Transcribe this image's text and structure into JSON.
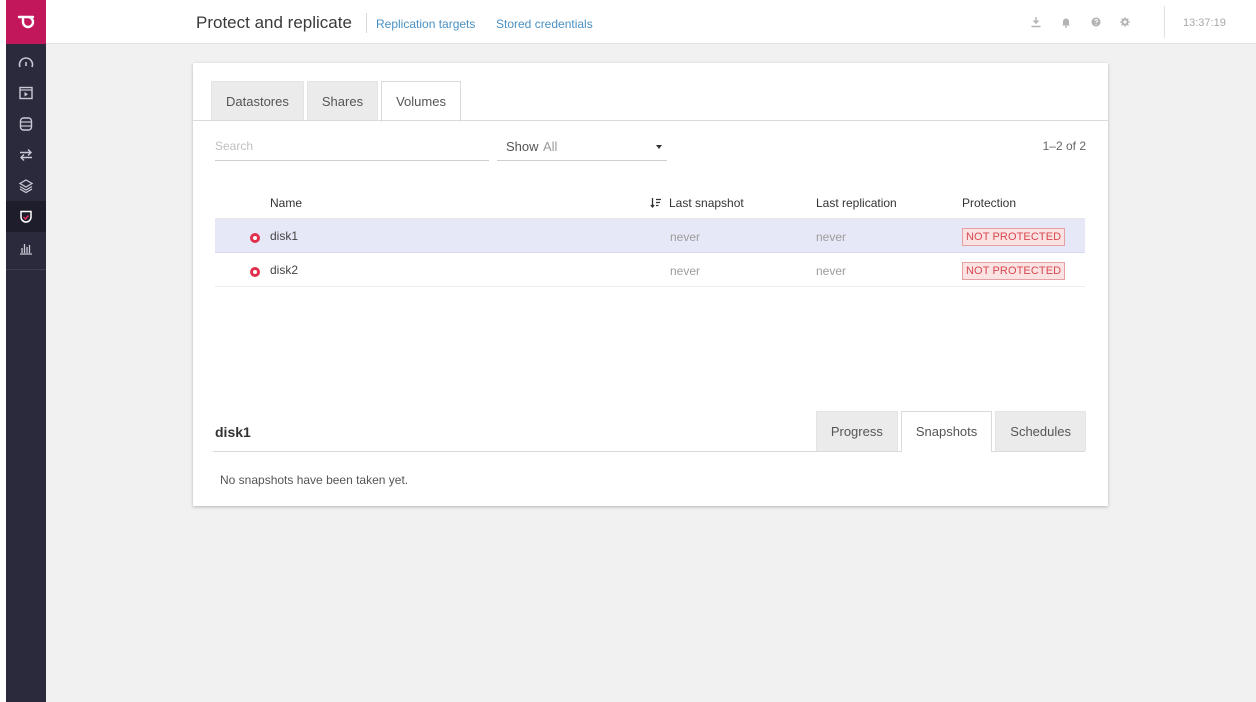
{
  "topbar": {
    "title": "Protect and replicate",
    "links": [
      "Replication targets",
      "Stored credentials"
    ],
    "clock": "13:37:19"
  },
  "sidebar": {
    "logo": "logo-icon",
    "items": [
      {
        "icon": "dashboard-icon"
      },
      {
        "icon": "vm-icon"
      },
      {
        "icon": "storage-icon"
      },
      {
        "icon": "transfer-icon"
      },
      {
        "icon": "layers-icon"
      },
      {
        "icon": "shield-icon",
        "active": true
      },
      {
        "icon": "stats-icon"
      }
    ]
  },
  "tabs": [
    "Datastores",
    "Shares",
    "Volumes"
  ],
  "active_tab": "Volumes",
  "search": {
    "placeholder": "Search"
  },
  "filter": {
    "label": "Show",
    "value": "All"
  },
  "pager": "1–2 of 2",
  "table": {
    "headers": [
      "Name",
      "Last snapshot",
      "Last replication",
      "Protection"
    ],
    "rows": [
      {
        "name": "disk1",
        "last_snapshot": "never",
        "last_replication": "never",
        "protection": "NOT PROTECTED",
        "selected": true
      },
      {
        "name": "disk2",
        "last_snapshot": "never",
        "last_replication": "never",
        "protection": "NOT PROTECTED",
        "selected": false
      }
    ]
  },
  "detail": {
    "title": "disk1",
    "tabs": [
      "Progress",
      "Snapshots",
      "Schedules"
    ],
    "active_tab": "Snapshots",
    "message": "No snapshots have been taken yet."
  },
  "colors": {
    "brand": "#c2185b",
    "sidebar": "#2a2a3c",
    "link": "#4a90c4",
    "danger": "#d9474e",
    "row_selected": "#e7e8f7"
  }
}
